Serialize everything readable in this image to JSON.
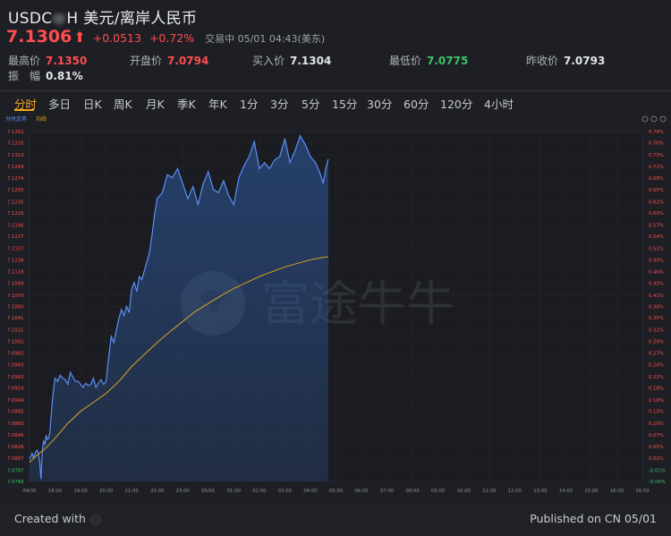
{
  "header": {
    "title_prefix": "USDC",
    "title_suffix": "H 美元/离岸人民币",
    "price": "7.1306",
    "change": "+0.0513",
    "change_pct": "+0.72%",
    "status": "交易中  05/01 04:43(美东)"
  },
  "stats": [
    {
      "label": "最高价",
      "value": "7.1350",
      "color": "red"
    },
    {
      "label": "开盘价",
      "value": "7.0794",
      "color": "red"
    },
    {
      "label": "买入价",
      "value": "7.1304",
      "color": "white"
    },
    {
      "label": "最低价",
      "value": "7.0775",
      "color": "green"
    },
    {
      "label": "昨收价",
      "value": "7.0793",
      "color": "white"
    },
    {
      "label": "振　幅",
      "value": "0.81%",
      "color": "white"
    }
  ],
  "tabs": [
    "分时",
    "多日",
    "日K",
    "周K",
    "月K",
    "季K",
    "年K",
    "1分",
    "3分",
    "5分",
    "15分",
    "30分",
    "60分",
    "120分",
    "4小时"
  ],
  "active_tab": "分时",
  "chart_labels": {
    "left": "分时走势",
    "right": "均线"
  },
  "watermark": "富途牛牛",
  "colors": {
    "up": "#ff4d4f",
    "down": "#3cc266",
    "line": "#5b8ff9",
    "avg": "#d9a520",
    "accent": "#f5a623"
  },
  "chart_data": {
    "type": "area",
    "prev_close": 7.0793,
    "y_ticks": [
      "7.1352",
      "7.1333",
      "7.1313",
      "7.1294",
      "7.1274",
      "7.1255",
      "7.1235",
      "7.1216",
      "7.1196",
      "7.1177",
      "7.1157",
      "7.1138",
      "7.1118",
      "7.1099",
      "7.1079",
      "7.1060",
      "7.1041",
      "7.1021",
      "7.1002",
      "7.0982",
      "7.0963",
      "7.0943",
      "7.0924",
      "7.0904",
      "7.0885",
      "7.0865",
      "7.0846",
      "7.0826",
      "7.0807",
      "7.0787",
      "7.0768"
    ],
    "y_pct_ticks": [
      "0.79%",
      "0.76%",
      "0.73%",
      "0.71%",
      "0.68%",
      "0.65%",
      "0.62%",
      "0.60%",
      "0.57%",
      "0.54%",
      "0.51%",
      "0.49%",
      "0.46%",
      "0.43%",
      "0.41%",
      "0.38%",
      "0.35%",
      "0.32%",
      "0.29%",
      "0.27%",
      "0.24%",
      "0.21%",
      "0.18%",
      "0.16%",
      "0.13%",
      "0.10%",
      "0.07%",
      "0.05%",
      "0.02%",
      "-0.01%",
      "-0.04%"
    ],
    "x_ticks": [
      "04/30",
      "18:00",
      "19:00",
      "20:00",
      "21:00",
      "22:00",
      "23:00",
      "05/01",
      "01:00",
      "02:00",
      "03:00",
      "04:00",
      "05:00",
      "06:00",
      "07:00",
      "08:00",
      "09:00",
      "10:00",
      "11:00",
      "12:00",
      "13:00",
      "14:00",
      "15:00",
      "16:00",
      "16:59"
    ],
    "price_series": {
      "name": "分时走势",
      "x": [
        0,
        0.05,
        0.1,
        0.15,
        0.2,
        0.25,
        0.3,
        0.35,
        0.4,
        0.45,
        0.5,
        0.55,
        0.6,
        0.65,
        0.7,
        0.75,
        0.8,
        0.85,
        0.9,
        0.95,
        1.0,
        1.1,
        1.2,
        1.3,
        1.4,
        1.5,
        1.6,
        1.7,
        1.8,
        1.9,
        2.0,
        2.1,
        2.2,
        2.3,
        2.4,
        2.5,
        2.6,
        2.7,
        2.8,
        2.9,
        3.0,
        3.1,
        3.2,
        3.3,
        3.4,
        3.5,
        3.6,
        3.7,
        3.8,
        3.9,
        4.0,
        4.1,
        4.2,
        4.3,
        4.4,
        4.5,
        4.6,
        4.7,
        4.8,
        4.9,
        5.0,
        5.2,
        5.4,
        5.6,
        5.8,
        6.0,
        6.2,
        6.4,
        6.6,
        6.8,
        7.0,
        7.2,
        7.4,
        7.6,
        7.8,
        8.0,
        8.2,
        8.4,
        8.6,
        8.8,
        9.0,
        9.2,
        9.4,
        9.6,
        9.8,
        10.0,
        10.2,
        10.4,
        10.6,
        10.8,
        11.0,
        11.2,
        11.4,
        11.5,
        11.6,
        11.7
      ],
      "y": [
        7.0805,
        7.081,
        7.0815,
        7.0808,
        7.0812,
        7.0818,
        7.082,
        7.0815,
        7.08,
        7.0772,
        7.082,
        7.0835,
        7.083,
        7.0845,
        7.0838,
        7.084,
        7.085,
        7.088,
        7.0905,
        7.0925,
        7.094,
        7.0935,
        7.0945,
        7.094,
        7.0938,
        7.093,
        7.095,
        7.0942,
        7.0935,
        7.0935,
        7.093,
        7.0925,
        7.0932,
        7.0928,
        7.093,
        7.094,
        7.0925,
        7.0932,
        7.0938,
        7.093,
        7.0935,
        7.0975,
        7.101,
        7.1,
        7.102,
        7.104,
        7.1055,
        7.1045,
        7.106,
        7.105,
        7.109,
        7.11,
        7.1085,
        7.111,
        7.1105,
        7.112,
        7.1135,
        7.115,
        7.118,
        7.1215,
        7.124,
        7.125,
        7.128,
        7.1275,
        7.129,
        7.1265,
        7.124,
        7.126,
        7.123,
        7.1265,
        7.1285,
        7.1255,
        7.125,
        7.127,
        7.1245,
        7.123,
        7.1275,
        7.1295,
        7.131,
        7.1335,
        7.129,
        7.13,
        7.129,
        7.1305,
        7.131,
        7.134,
        7.13,
        7.132,
        7.1345,
        7.133,
        7.131,
        7.13,
        7.128,
        7.1265,
        7.129,
        7.1306
      ]
    },
    "avg_series": {
      "name": "均线",
      "x": [
        0,
        0.3,
        0.6,
        1.0,
        1.5,
        2.0,
        2.5,
        3.0,
        3.5,
        4.0,
        4.5,
        5.0,
        5.5,
        6.0,
        6.5,
        7.0,
        7.5,
        8.0,
        8.5,
        9.0,
        9.5,
        10.0,
        10.5,
        11.0,
        11.5,
        11.7
      ],
      "y": [
        7.08,
        7.0812,
        7.0822,
        7.084,
        7.0865,
        7.0885,
        7.09,
        7.0915,
        7.0935,
        7.096,
        7.098,
        7.1,
        7.1018,
        7.1035,
        7.1052,
        7.1065,
        7.1078,
        7.109,
        7.11,
        7.111,
        7.1118,
        7.1126,
        7.1132,
        7.1138,
        7.1142,
        7.1143
      ]
    }
  },
  "footer": {
    "left": "Created with",
    "right": "Published on CN 05/01"
  }
}
